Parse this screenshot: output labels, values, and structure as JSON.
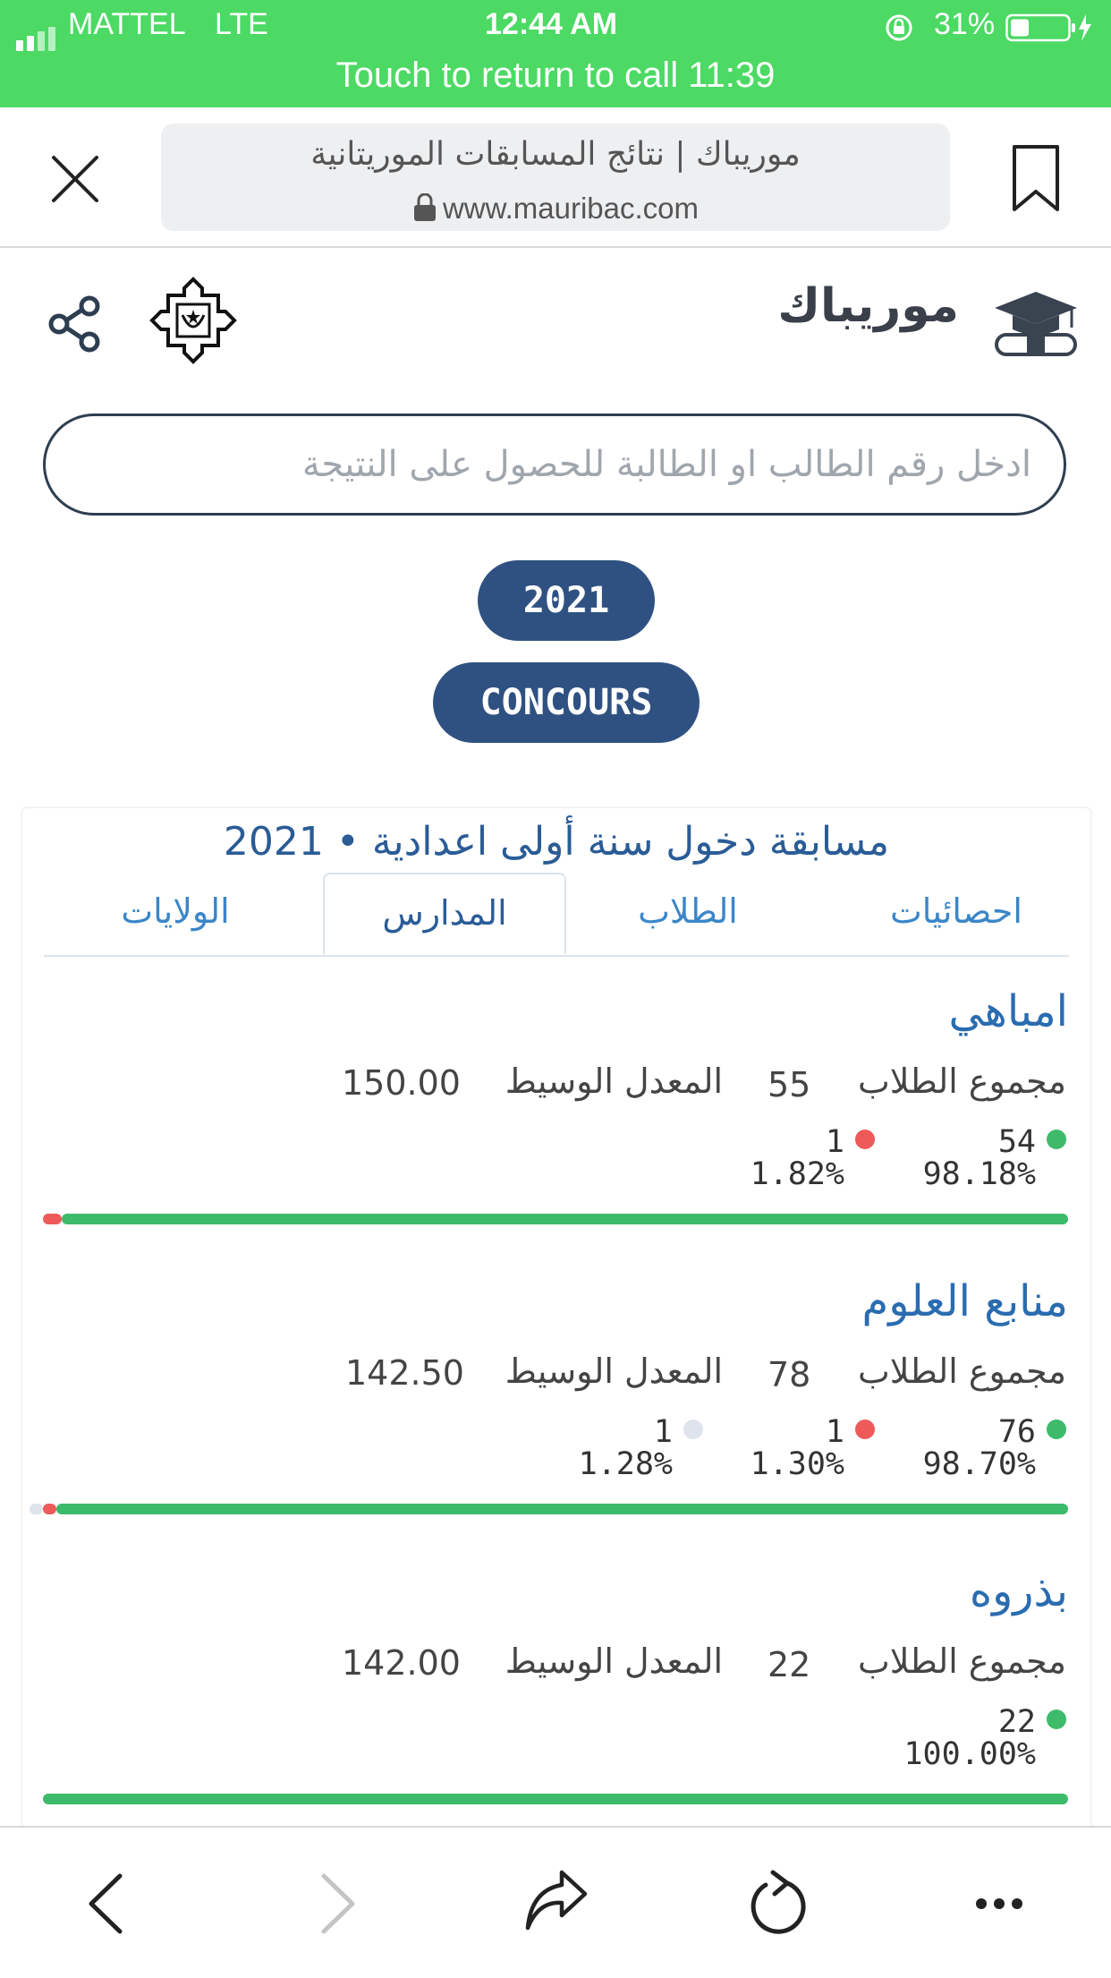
{
  "status_bar": {
    "carrier": "MATTEL",
    "network": "LTE",
    "time": "12:44 AM",
    "battery": "31%",
    "call_banner": "Touch to return to call 11:39"
  },
  "browser": {
    "page_title": "موريباك | نتائج المسابقات الموريتانية",
    "url": "www.mauribac.com"
  },
  "header": {
    "brand": "موريباك"
  },
  "search": {
    "placeholder": "ادخل رقم الطالب او الطالبة للحصول على النتيجة"
  },
  "filters": {
    "year": "2021",
    "type": "CONCOURS"
  },
  "card": {
    "title": "مسابقة دخول سنة أولى اعدادية • 2021",
    "tabs": [
      "احصائيات",
      "الطلاب",
      "المدارس",
      "الولايات"
    ],
    "active_tab": "المدارس",
    "total_label": "مجموع الطلاب",
    "avg_label": "المعدل الوسيط",
    "schools": [
      {
        "name": "امباهي",
        "total": "55",
        "avg": "150.00",
        "results": [
          {
            "count": "54",
            "pct": "98.18%",
            "color": "#3dba6a"
          },
          {
            "count": "1",
            "pct": "1.82%",
            "color": "#ee5a5a"
          }
        ]
      },
      {
        "name": "منابع العلوم",
        "total": "78",
        "avg": "142.50",
        "results": [
          {
            "count": "76",
            "pct": "98.70%",
            "color": "#3dba6a"
          },
          {
            "count": "1",
            "pct": "1.30%",
            "color": "#ee5a5a"
          },
          {
            "count": "1",
            "pct": "1.28%",
            "color": "#dfe4ec"
          }
        ]
      },
      {
        "name": "بذروه",
        "total": "22",
        "avg": "142.00",
        "results": [
          {
            "count": "22",
            "pct": "100.00%",
            "color": "#3dba6a"
          }
        ]
      }
    ]
  },
  "colors": {
    "status_green": "#4cd964",
    "navy": "#2f5182",
    "link_blue": "#2a6cb0",
    "success": "#3dba6a",
    "fail": "#ee5a5a",
    "absent": "#dfe4ec"
  }
}
